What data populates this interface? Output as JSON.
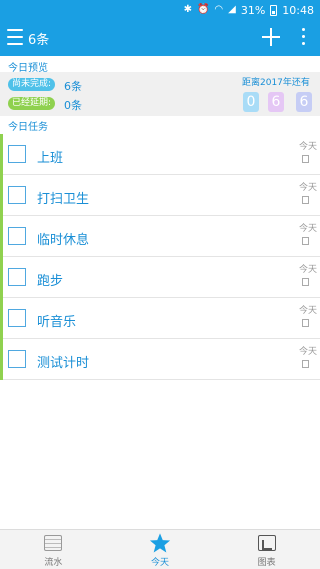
{
  "status": {
    "battery": "31%",
    "time": "10:48"
  },
  "appbar": {
    "title": "6条"
  },
  "preview": {
    "label": "今日预览",
    "unfinished_label": "尚未完成:",
    "unfinished_value": "6条",
    "delayed_label": "已经延期:",
    "delayed_value": "0条",
    "until_label": "距离2017年还有",
    "days_digits": [
      "0",
      "6",
      "6"
    ]
  },
  "tasks": {
    "label": "今日任务",
    "items": [
      {
        "title": "上班",
        "date": "今天"
      },
      {
        "title": "打扫卫生",
        "date": "今天"
      },
      {
        "title": "临时休息",
        "date": "今天"
      },
      {
        "title": "跑步",
        "date": "今天"
      },
      {
        "title": "听音乐",
        "date": "今天"
      },
      {
        "title": "测试计时",
        "date": "今天"
      }
    ]
  },
  "tabs": [
    {
      "label": "流水",
      "icon": "list-icon"
    },
    {
      "label": "今天",
      "icon": "star-icon"
    },
    {
      "label": "图表",
      "icon": "chart-icon"
    }
  ],
  "colors": {
    "primary": "#1a9fe3",
    "accent_green": "#8fd14f"
  }
}
